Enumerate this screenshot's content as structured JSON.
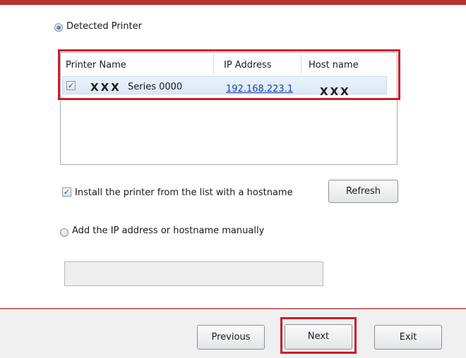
{
  "detected_printer": {
    "label": "Detected Printer",
    "selected": true
  },
  "printer_list": {
    "columns": [
      "Printer Name",
      "IP Address",
      "Host name"
    ],
    "rows": [
      {
        "checked": true,
        "name_prefix": "XXX",
        "name_suffix": "Series 0000",
        "ip": "192.168.223.1",
        "host": "XXX"
      }
    ]
  },
  "install_hostname": {
    "label": "Install the printer from the list with a hostname",
    "checked": true
  },
  "refresh_button": "Refresh",
  "manual_entry": {
    "label": "Add the IP address or hostname manually",
    "selected": false,
    "value": ""
  },
  "footer": {
    "previous": "Previous",
    "next": "Next",
    "exit": "Exit"
  },
  "colors": {
    "highlight": "#c8202a",
    "accent_bar": "#b8322e",
    "link": "#1a3ea8"
  }
}
